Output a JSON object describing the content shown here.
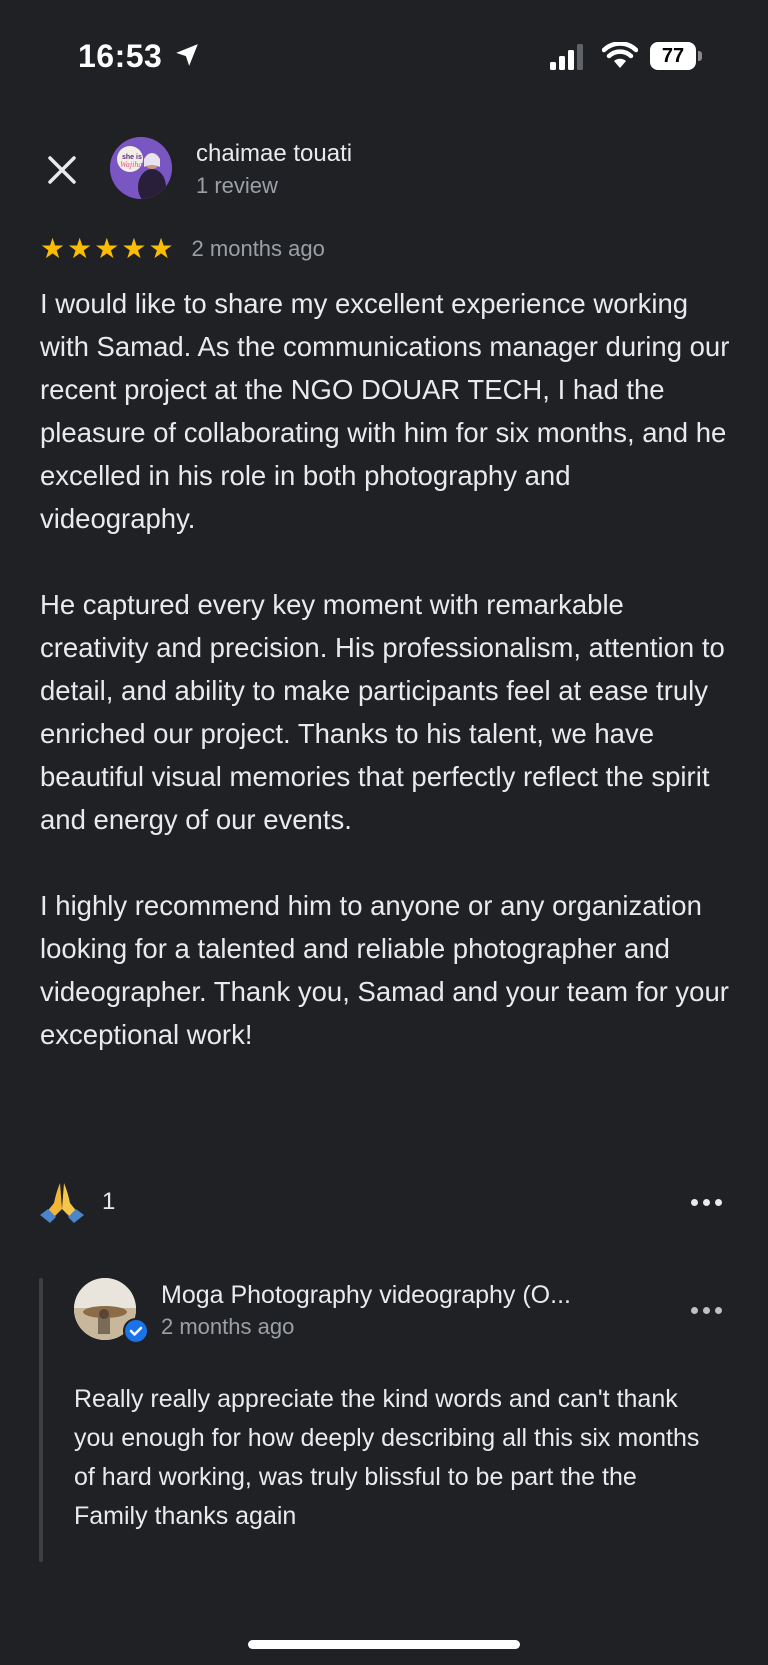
{
  "status_bar": {
    "time": "16:53",
    "battery": "77"
  },
  "review": {
    "reviewer_name": "chaimae touati",
    "reviewer_meta": "1 review",
    "rating": 5,
    "time": "2 months ago",
    "paragraphs": [
      "I would like to share my excellent experience working with Samad. As the communications manager during our recent project at the NGO DOUAR TECH, I had the pleasure of collaborating with him for six months, and he excelled in his role in both photography and videography.",
      "He captured every key moment with remarkable creativity and precision. His professionalism, attention to detail, and ability to make participants feel at ease truly enriched our project. Thanks to his talent, we have beautiful visual memories that perfectly reflect the spirit and energy of our events.",
      "I highly recommend him to anyone or any organization looking for a talented and reliable photographer and videographer. Thank you, Samad and your team for your exceptional work!"
    ],
    "reaction_count": "1"
  },
  "owner_reply": {
    "name": "Moga Photography videography (O...",
    "time": "2 months ago",
    "text": "Really really appreciate the kind words and can't thank you enough for how deeply describing all this six months of hard working, was truly blissful to be part the the Family thanks again"
  },
  "colors": {
    "background": "#202124",
    "star": "#fbbc04",
    "verified": "#1a73e8",
    "secondary_text": "#9aa0a6"
  },
  "icons": [
    "location-arrow-icon",
    "signal-icon",
    "wifi-icon",
    "battery-icon",
    "close-icon",
    "star-icon",
    "folded-hands-icon",
    "more-options-icon",
    "verified-badge-icon"
  ]
}
